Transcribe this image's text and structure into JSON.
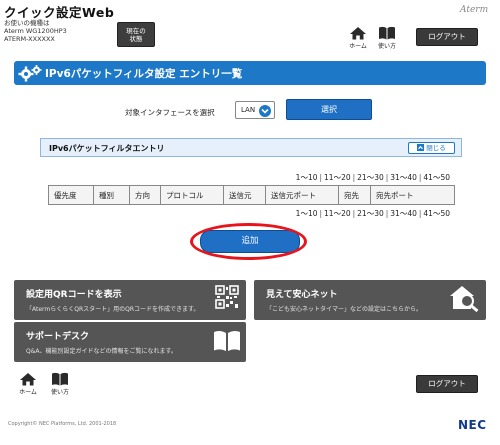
{
  "header": {
    "app_title": "クイック設定Web",
    "device_label": "お使いの機種は",
    "device_model": "Aterm WG1200HP3",
    "device_id": "ATERM-XXXXXX",
    "status_line1": "現在の",
    "status_line2": "状態",
    "brand": "Aterm",
    "home_label": "ホーム",
    "help_label": "使い方",
    "logout_label": "ログアウト"
  },
  "page": {
    "title": "IPv6パケットフィルタ設定 エントリ一覧"
  },
  "interface_select": {
    "label": "対象インタフェースを選択",
    "value": "LAN",
    "button_label": "選択"
  },
  "entry_section": {
    "title": "IPv6パケットフィルタエントリ",
    "close_label": "閉じる"
  },
  "pager": {
    "ranges": [
      "1〜10",
      "11〜20",
      "21〜30",
      "31〜40",
      "41〜50"
    ],
    "separator": "|"
  },
  "table": {
    "columns": [
      "優先度",
      "種別",
      "方向",
      "プロトコル",
      "送信元",
      "送信元ポート",
      "宛先",
      "宛先ポート"
    ]
  },
  "add_button": "追加",
  "links": [
    {
      "title": "設定用QRコードを表示",
      "desc": "「AtermらくらくQRスタート」用のQRコードを作成できます。",
      "icon": "qr-code-icon"
    },
    {
      "title": "見えて安心ネット",
      "desc": "「こども安心ネットタイマー」などの設定はこちらから。",
      "icon": "house-search-icon"
    },
    {
      "title": "サポートデスク",
      "desc": "Q&A、機能別設定ガイドなどの情報をご覧になれます。",
      "icon": "book-icon"
    }
  ],
  "footer": {
    "home_label": "ホーム",
    "help_label": "使い方",
    "logout_label": "ログアウト",
    "copyright": "Copyright© NEC Platforms, Ltd. 2001-2018",
    "logo": "NEC"
  },
  "colors": {
    "accent_blue": "#1e78c8",
    "dark_gray": "#555555",
    "highlight_red": "#e8141c"
  }
}
